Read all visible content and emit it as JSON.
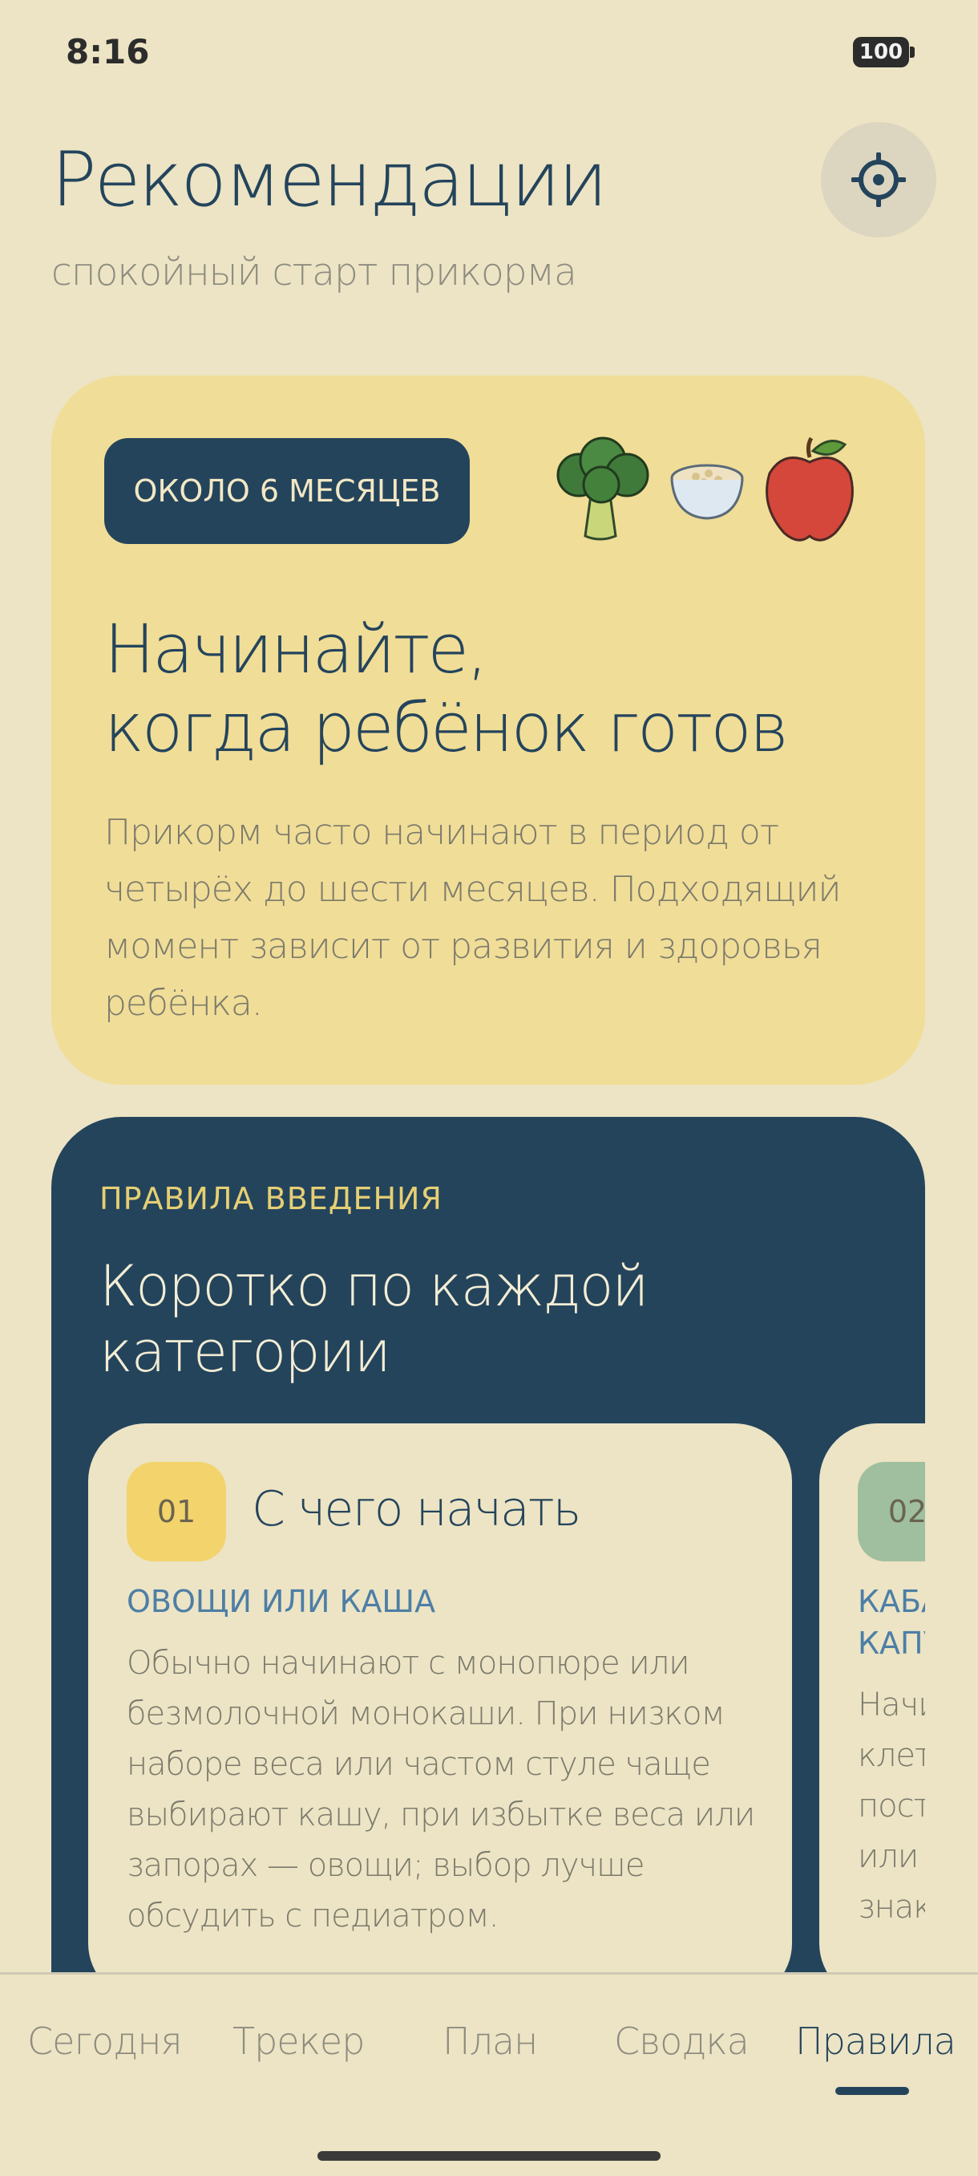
{
  "status_bar": {
    "time": "8:16",
    "battery": "100"
  },
  "header": {
    "title": "Рекомендации",
    "subtitle": "спокойный старт прикорма",
    "settings_icon": "settings-sun-icon"
  },
  "hero": {
    "badge": "ОКОЛО 6 МЕСЯЦЕВ",
    "food_icons": [
      "broccoli-icon",
      "porridge-bowl-icon",
      "apple-icon"
    ],
    "title_line1": "Начинайте,",
    "title_line2": "когда ребёнок готов",
    "text": "Прикорм часто начинают в период от четырёх до шести месяцев. Подходящий момент зависит от развития и здоровья ребёнка."
  },
  "rules": {
    "kicker": "ПРАВИЛА ВВЕДЕНИЯ",
    "title": "Коротко по каждой категории",
    "cards": [
      {
        "number": "01",
        "title": "С чего начать",
        "subtitle": "ОВОЩИ ИЛИ КАША",
        "text": "Обычно начинают с монопюре или безмолочной монокаши. При низком наборе веса или частом стуле чаще выбирают кашу, при избытке веса или запорах — овощи; выбор лучше обсудить с педиатром."
      },
      {
        "number": "02",
        "subtitle": "КАБА КАПУ",
        "text": "Начи клет пост или знак"
      }
    ]
  },
  "bottom_nav": {
    "items": [
      "Сегодня",
      "Трекер",
      "План",
      "Сводка",
      "Правила"
    ],
    "active": "Правила"
  },
  "colors": {
    "background": "#ece4c4",
    "navy": "#24445c",
    "hero_yellow": "#f0dd97",
    "accent_yellow": "#f3d36c",
    "accent_green": "#9fbf9e",
    "link_blue": "#4d7ea6"
  }
}
